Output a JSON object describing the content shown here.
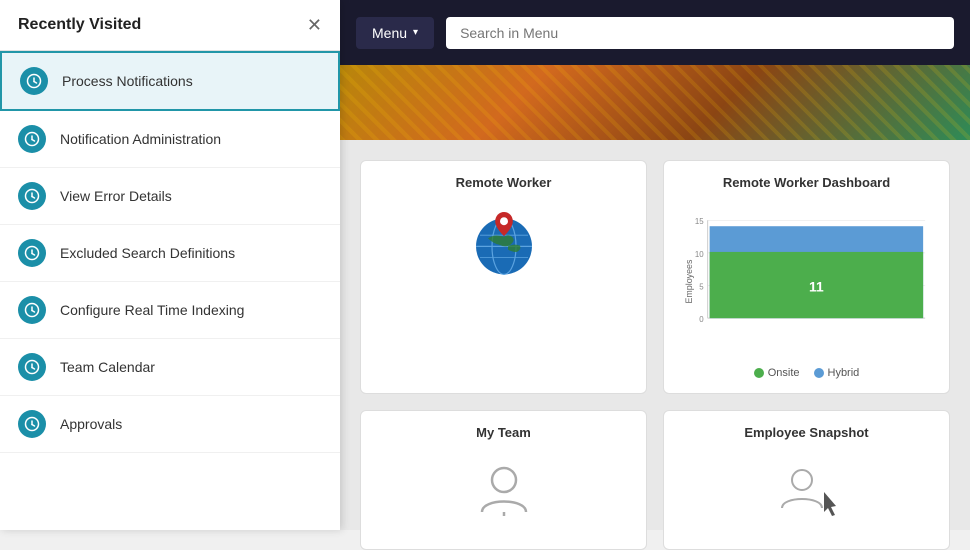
{
  "topbar": {
    "menu_label": "Menu",
    "search_placeholder": "Search in Menu"
  },
  "sidebar": {
    "title": "Recently Visited",
    "items": [
      {
        "id": "process-notifications",
        "label": "Process Notifications",
        "active": true
      },
      {
        "id": "notification-administration",
        "label": "Notification Administration",
        "active": false
      },
      {
        "id": "view-error-details",
        "label": "View Error Details",
        "active": false
      },
      {
        "id": "excluded-search-definitions",
        "label": "Excluded Search Definitions",
        "active": false
      },
      {
        "id": "configure-real-time-indexing",
        "label": "Configure Real Time Indexing",
        "active": false
      },
      {
        "id": "team-calendar",
        "label": "Team Calendar",
        "active": false
      },
      {
        "id": "approvals",
        "label": "Approvals",
        "active": false
      }
    ]
  },
  "cards": {
    "remote_worker": {
      "title": "Remote Worker"
    },
    "remote_worker_dashboard": {
      "title": "Remote Worker Dashboard",
      "chart": {
        "y_label": "Employees",
        "max": 15,
        "ticks": [
          15,
          10,
          5,
          0
        ],
        "bar_value": 11,
        "colors": {
          "onsite": "#4cae4c",
          "hybrid": "#5b9bd5"
        }
      },
      "legend": [
        {
          "label": "Onsite",
          "color": "#4cae4c"
        },
        {
          "label": "Hybrid",
          "color": "#5b9bd5"
        }
      ]
    },
    "my_team": {
      "title": "My Team"
    },
    "employee_snapshot": {
      "title": "Employee Snapshot"
    }
  }
}
